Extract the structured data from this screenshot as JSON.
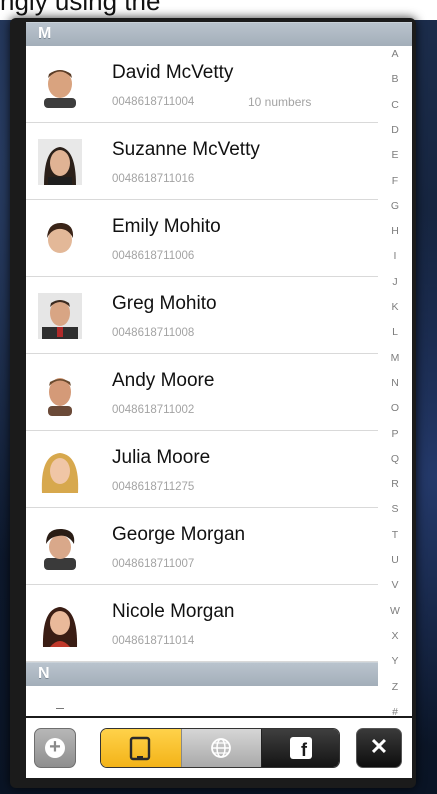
{
  "top_text": "ngly using the",
  "sections": [
    {
      "letter": "M"
    },
    {
      "letter": "N"
    }
  ],
  "contacts": [
    {
      "name": "David McVetty",
      "phone": "0048618711004",
      "extra": "10 numbers",
      "avatar": "man-avatar"
    },
    {
      "name": "Suzanne McVetty",
      "phone": "0048618711016",
      "avatar": "woman-avatar"
    },
    {
      "name": "Emily Mohito",
      "phone": "0048618711006",
      "avatar": "woman-avatar"
    },
    {
      "name": "Greg Mohito",
      "phone": "0048618711008",
      "avatar": "man-avatar"
    },
    {
      "name": "Andy Moore",
      "phone": "0048618711002",
      "avatar": "man-avatar"
    },
    {
      "name": "Julia Moore",
      "phone": "0048618711275",
      "avatar": "woman-avatar"
    },
    {
      "name": "George Morgan",
      "phone": "0048618711007",
      "avatar": "man-avatar"
    },
    {
      "name": "Nicole Morgan",
      "phone": "0048618711014",
      "avatar": "woman-avatar"
    }
  ],
  "index_letters": [
    "A",
    "B",
    "C",
    "D",
    "E",
    "F",
    "G",
    "H",
    "I",
    "J",
    "K",
    "L",
    "M",
    "N",
    "O",
    "P",
    "Q",
    "R",
    "S",
    "T",
    "U",
    "V",
    "W",
    "X",
    "Y",
    "Z",
    "#"
  ],
  "toolbar": {
    "add_icon": "plus-icon",
    "segments": [
      {
        "icon": "device-icon",
        "selected": true
      },
      {
        "icon": "globe-icon",
        "selected": false
      },
      {
        "icon": "facebook-icon",
        "label": "f",
        "selected": false
      }
    ],
    "close_label": "✕"
  },
  "colors": {
    "selected_segment": "#f3b318",
    "section_header": "#a3aeb9",
    "secondary_text": "#a3a3a3"
  }
}
